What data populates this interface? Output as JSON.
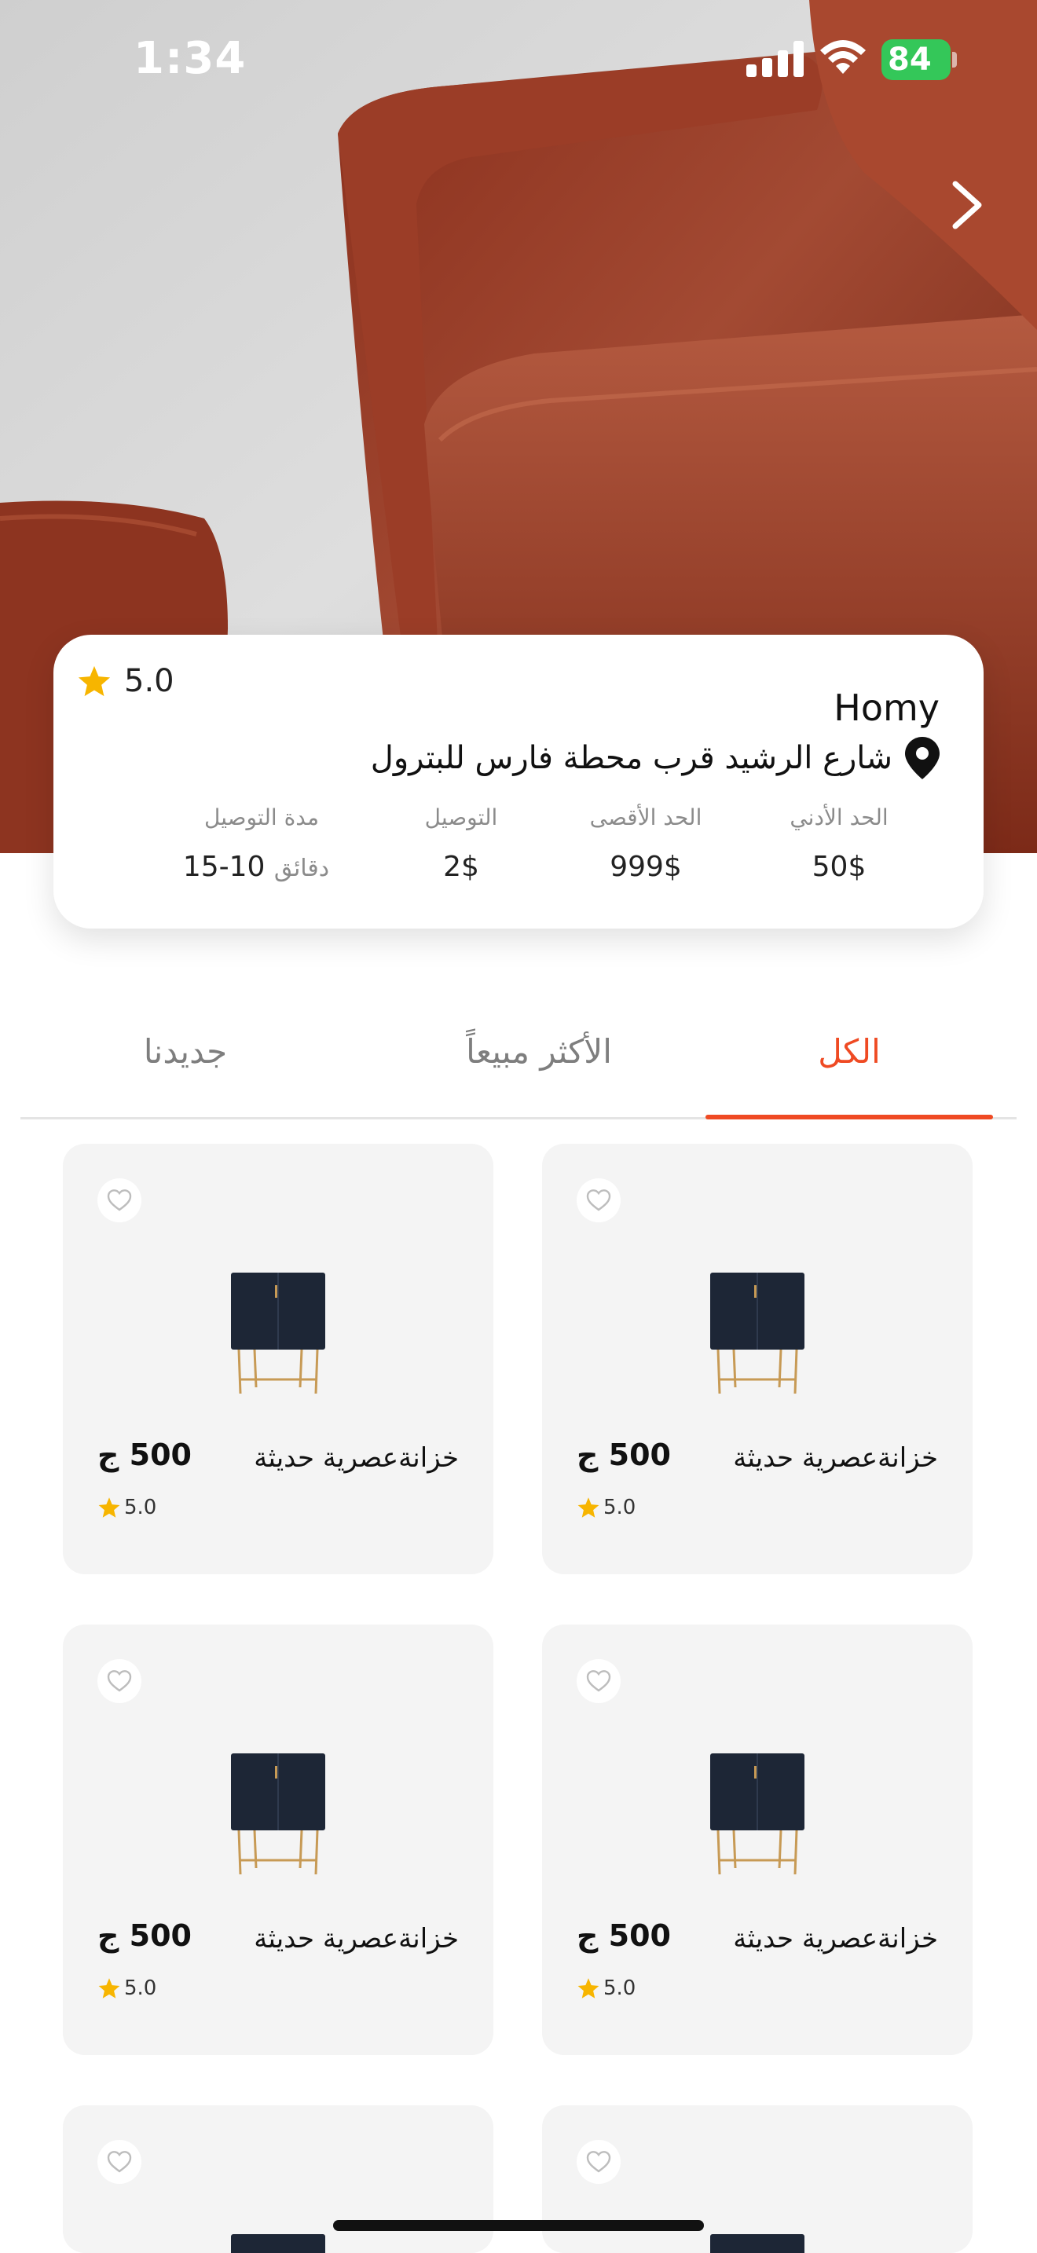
{
  "status_bar": {
    "time": "1:34",
    "battery": "84"
  },
  "shop": {
    "name": "Homy",
    "rating": "5.0",
    "address": "شارع الرشيد قرب محطة فارس للبترول",
    "stats": {
      "min_label": "الحد الأدني",
      "min_value": "50$",
      "max_label": "الحد الأقصى",
      "max_value": "999$",
      "delivery_label": "التوصيل",
      "delivery_value": "2$",
      "time_label": "مدة التوصيل",
      "time_value": "10-15",
      "time_unit": "دقائق"
    }
  },
  "tabs": {
    "all": "الكل",
    "best": "الأكثر مبيعاً",
    "new": "جديدنا"
  },
  "products": [
    {
      "name": "خزانةعصرية حديثة",
      "price": "500 ج",
      "rating": "5.0"
    },
    {
      "name": "خزانةعصرية حديثة",
      "price": "500 ج",
      "rating": "5.0"
    },
    {
      "name": "خزانةعصرية حديثة",
      "price": "500 ج",
      "rating": "5.0"
    },
    {
      "name": "خزانةعصرية حديثة",
      "price": "500 ج",
      "rating": "5.0"
    }
  ],
  "colors": {
    "accent": "#ef4a23",
    "star": "#f7b500",
    "battery": "#34c759",
    "card_bg": "#f4f4f4"
  },
  "icons": [
    "chevron-right-icon",
    "star-icon",
    "location-pin-icon",
    "heart-icon",
    "signal-icon",
    "wifi-icon",
    "battery-icon"
  ]
}
